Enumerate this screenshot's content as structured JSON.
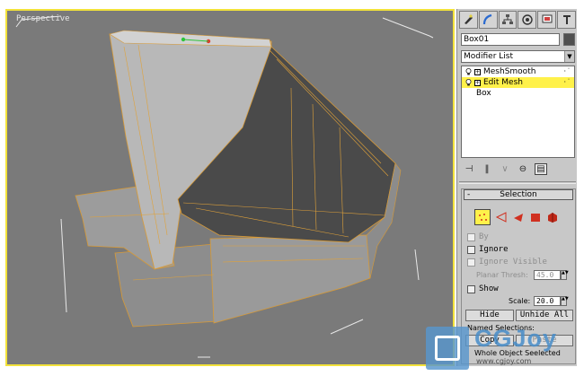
{
  "viewport": {
    "label": "Perspective"
  },
  "panel": {
    "tabs": [
      "create-icon",
      "modify-icon",
      "hierarchy-icon",
      "motion-icon",
      "display-icon",
      "utilities-icon"
    ],
    "object_name": "Box01",
    "object_color": "#505050",
    "modifier_list": {
      "selected": "Modifier List"
    },
    "stack": [
      {
        "label": "MeshSmooth",
        "selected": false
      },
      {
        "label": "Edit Mesh",
        "selected": true
      },
      {
        "label": "Box",
        "selected": false
      }
    ],
    "selection": {
      "title": "Selection",
      "by_label": "By",
      "ignore_backfacing_label": "Ignore",
      "ignore_visible_label": "Ignore Visible",
      "planar_thresh_label": "Planar Thresh:",
      "planar_thresh_value": "45.0",
      "show_label": "Show",
      "scale_label": "Scale:",
      "scale_value": "20.0",
      "hide_label": "Hide",
      "unhide_all_label": "Unhide All",
      "named_selections_label": "Named Selections:",
      "copy_label": "Copy",
      "paste_label": "Paste",
      "whole_object_label": "Whole Object Se",
      "selected_label": "elected"
    }
  },
  "watermark": {
    "brand": "CGJoy",
    "url": "www.cgjoy.com"
  },
  "colors": {
    "viewport_bg": "#7a7a7a",
    "active_border": "#f2e23a",
    "selection_highlight": "#fff14a",
    "wireframe": "#e0a23a"
  }
}
